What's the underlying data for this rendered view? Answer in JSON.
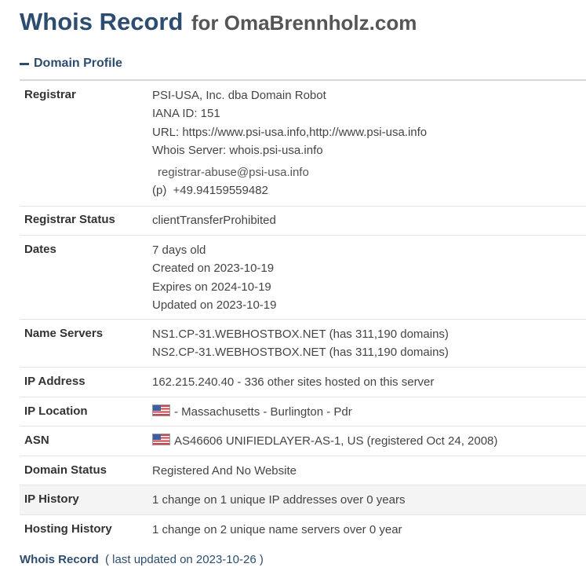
{
  "header": {
    "title": "Whois Record",
    "subtitle": "for OmaBrennholz.com"
  },
  "section": {
    "title": "Domain Profile"
  },
  "registrar": {
    "label": "Registrar",
    "name": "PSI-USA, Inc. dba Domain Robot",
    "iana": "IANA ID: 151",
    "url": "URL: https://www.psi-usa.info,http://www.psi-usa.info",
    "whois_server": "Whois Server: whois.psi-usa.info",
    "email": "registrar-abuse@psi-usa.info",
    "phone_prefix": "(p)",
    "phone": "+49.94159559482"
  },
  "registrar_status": {
    "label": "Registrar Status",
    "value": "clientTransferProhibited"
  },
  "dates": {
    "label": "Dates",
    "age": "7 days old",
    "created": "Created on 2023-10-19",
    "expires": "Expires on 2024-10-19",
    "updated": "Updated on 2023-10-19"
  },
  "name_servers": {
    "label": "Name Servers",
    "ns1": "NS1.CP-31.WEBHOSTBOX.NET (has 311,190 domains)",
    "ns2": "NS2.CP-31.WEBHOSTBOX.NET (has 311,190 domains)"
  },
  "ip_address": {
    "label": "IP Address",
    "value": "162.215.240.40 - 336 other sites hosted on this server"
  },
  "ip_location": {
    "label": "IP Location",
    "value": "- Massachusetts - Burlington - Pdr"
  },
  "asn": {
    "label": "ASN",
    "value": "AS46606 UNIFIEDLAYER-AS-1, US (registered Oct 24, 2008)"
  },
  "domain_status": {
    "label": "Domain Status",
    "value": "Registered And No Website"
  },
  "ip_history": {
    "label": "IP History",
    "value": "1 change on 1 unique IP addresses over 0 years"
  },
  "hosting_history": {
    "label": "Hosting History",
    "value": "1 change on 2 unique name servers over 0 year"
  },
  "footer": {
    "link": "Whois Record",
    "note": "( last updated on 2023-10-26 )"
  },
  "icons": {
    "flag": "us-flag-icon"
  }
}
